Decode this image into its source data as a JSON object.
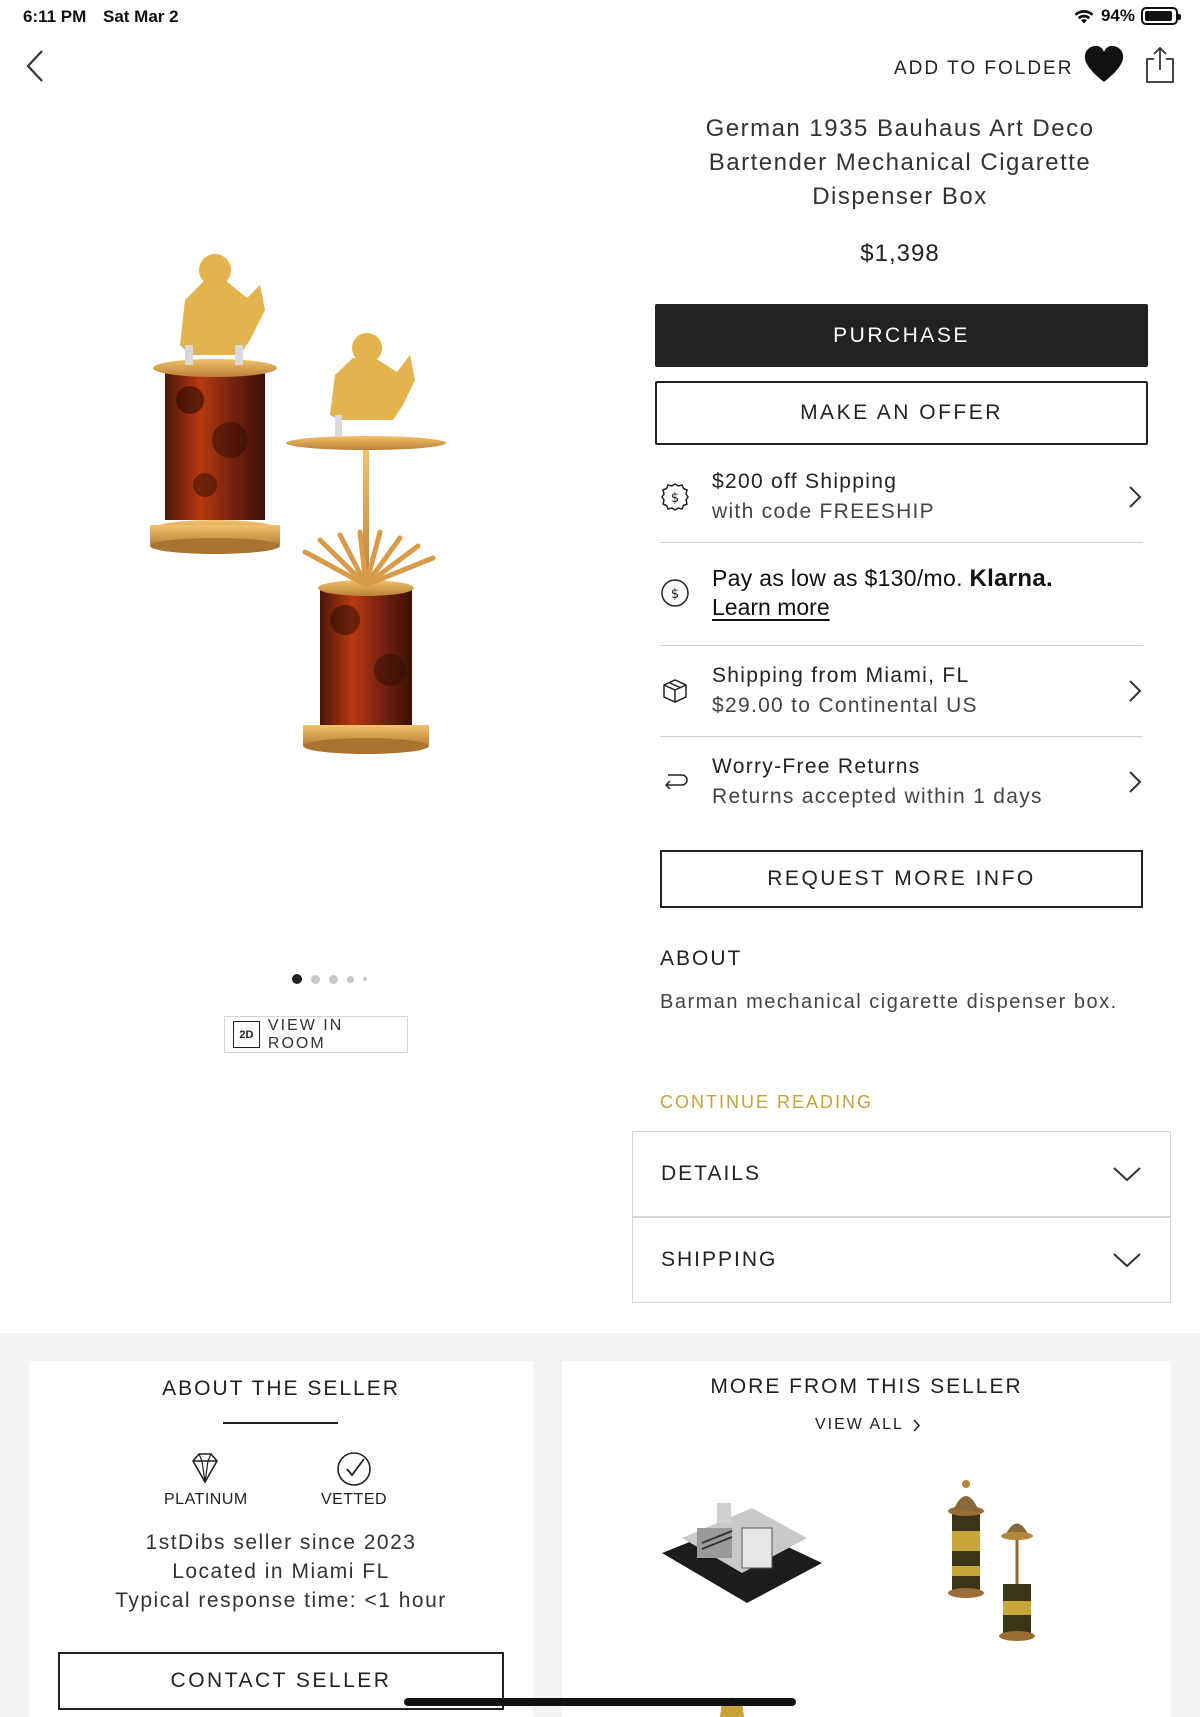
{
  "status_bar": {
    "time": "6:11 PM",
    "date": "Sat Mar 2",
    "battery": "94%",
    "battery_level": 0.94
  },
  "nav": {
    "add_to_folder": "ADD TO FOLDER"
  },
  "product": {
    "title": "German 1935 Bauhaus Art Deco Bartender Mechanical Cigarette Dispenser Box",
    "price": "$1,398",
    "image_count": 5,
    "active_image": 1,
    "view_in_room_badge": "2D",
    "view_in_room": "VIEW IN ROOM"
  },
  "actions": {
    "purchase": "PURCHASE",
    "make_offer": "MAKE AN OFFER",
    "request_info": "REQUEST MORE INFO"
  },
  "info_rows": {
    "promo": {
      "line1": "$200 off Shipping",
      "line2": "with code FREESHIP",
      "icon": "dollar-circle-icon"
    },
    "klarna": {
      "text": "Pay as low as $130/mo.",
      "brand": "Klarna.",
      "link": "Learn more",
      "icon": "dollar-circle-icon"
    },
    "shipping": {
      "line1": "Shipping from Miami, FL",
      "line2": "$29.00 to Continental US",
      "icon": "package-icon"
    },
    "returns": {
      "line1": "Worry-Free Returns",
      "line2": "Returns accepted within 1 days",
      "icon": "return-arrow-icon"
    }
  },
  "about": {
    "heading": "ABOUT",
    "body": "Barman mechanical cigarette dispenser box.",
    "continue": "CONTINUE READING"
  },
  "accordions": {
    "details": "DETAILS",
    "shipping": "SHIPPING"
  },
  "seller": {
    "heading": "ABOUT THE SELLER",
    "badge1": "PLATINUM",
    "badge2": "VETTED",
    "since": "1stDibs seller since 2023",
    "location": "Located in Miami FL",
    "response": "Typical response time: <1 hour",
    "contact": "CONTACT SELLER"
  },
  "more": {
    "heading": "MORE FROM THIS SELLER",
    "view_all": "VIEW ALL"
  },
  "colors": {
    "accent_gold": "#c2a43b",
    "dark": "#222222"
  }
}
